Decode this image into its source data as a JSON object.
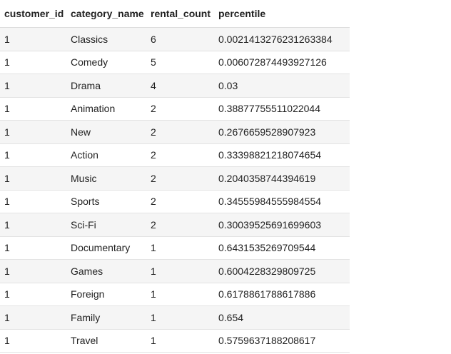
{
  "table": {
    "columns": [
      "customer_id",
      "category_name",
      "rental_count",
      "percentile"
    ],
    "rows": [
      [
        "1",
        "Classics",
        "6",
        "0.0021413276231263384"
      ],
      [
        "1",
        "Comedy",
        "5",
        "0.006072874493927126"
      ],
      [
        "1",
        "Drama",
        "4",
        "0.03"
      ],
      [
        "1",
        "Animation",
        "2",
        "0.38877755511022044"
      ],
      [
        "1",
        "New",
        "2",
        "0.2676659528907923"
      ],
      [
        "1",
        "Action",
        "2",
        "0.33398821218074654"
      ],
      [
        "1",
        "Music",
        "2",
        "0.2040358744394619"
      ],
      [
        "1",
        "Sports",
        "2",
        "0.34555984555984554"
      ],
      [
        "1",
        "Sci-Fi",
        "2",
        "0.30039525691699603"
      ],
      [
        "1",
        "Documentary",
        "1",
        "0.6431535269709544"
      ],
      [
        "1",
        "Games",
        "1",
        "0.6004228329809725"
      ],
      [
        "1",
        "Foreign",
        "1",
        "0.6178861788617886"
      ],
      [
        "1",
        "Family",
        "1",
        "0.654"
      ],
      [
        "1",
        "Travel",
        "1",
        "0.5759637188208617"
      ]
    ]
  }
}
